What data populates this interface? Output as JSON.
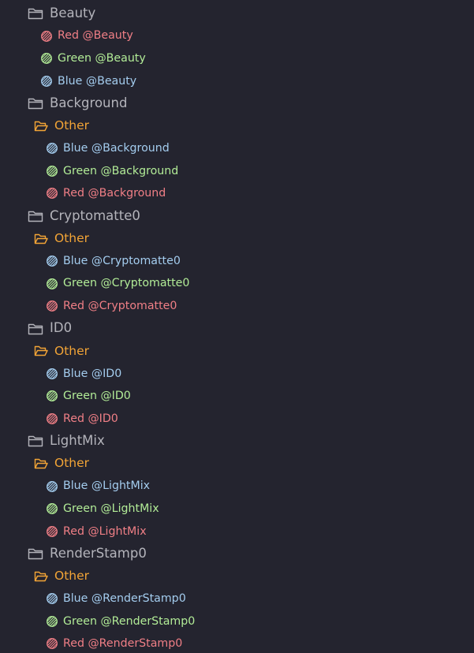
{
  "colors": {
    "background": "#24242f",
    "group_text": "#b4b4bb",
    "other_folder": "#f2a436",
    "red": "#f07f86",
    "green": "#b2ec97",
    "blue": "#a4cdef"
  },
  "tree": [
    {
      "label": "Beauty",
      "icon": "folder-icon",
      "children": [
        {
          "label": "Red @Beauty",
          "color": "red",
          "icon": "hatched-circle-icon"
        },
        {
          "label": "Green @Beauty",
          "color": "green",
          "icon": "hatched-circle-icon"
        },
        {
          "label": "Blue @Beauty",
          "color": "blue",
          "icon": "hatched-circle-icon"
        }
      ]
    },
    {
      "label": "Background",
      "icon": "folder-icon",
      "subfolder": {
        "label": "Other",
        "icon": "open-folder-icon",
        "children": [
          {
            "label": "Blue @Background",
            "color": "blue",
            "icon": "hatched-circle-icon"
          },
          {
            "label": "Green @Background",
            "color": "green",
            "icon": "hatched-circle-icon"
          },
          {
            "label": "Red @Background",
            "color": "red",
            "icon": "hatched-circle-icon"
          }
        ]
      }
    },
    {
      "label": "Cryptomatte0",
      "icon": "folder-icon",
      "subfolder": {
        "label": "Other",
        "icon": "open-folder-icon",
        "children": [
          {
            "label": "Blue @Cryptomatte0",
            "color": "blue",
            "icon": "hatched-circle-icon"
          },
          {
            "label": "Green @Cryptomatte0",
            "color": "green",
            "icon": "hatched-circle-icon"
          },
          {
            "label": "Red @Cryptomatte0",
            "color": "red",
            "icon": "hatched-circle-icon"
          }
        ]
      }
    },
    {
      "label": "ID0",
      "icon": "folder-icon",
      "subfolder": {
        "label": "Other",
        "icon": "open-folder-icon",
        "children": [
          {
            "label": "Blue @ID0",
            "color": "blue",
            "icon": "hatched-circle-icon"
          },
          {
            "label": "Green @ID0",
            "color": "green",
            "icon": "hatched-circle-icon"
          },
          {
            "label": "Red @ID0",
            "color": "red",
            "icon": "hatched-circle-icon"
          }
        ]
      }
    },
    {
      "label": "LightMix",
      "icon": "folder-icon",
      "subfolder": {
        "label": "Other",
        "icon": "open-folder-icon",
        "children": [
          {
            "label": "Blue @LightMix",
            "color": "blue",
            "icon": "hatched-circle-icon"
          },
          {
            "label": "Green @LightMix",
            "color": "green",
            "icon": "hatched-circle-icon"
          },
          {
            "label": "Red @LightMix",
            "color": "red",
            "icon": "hatched-circle-icon"
          }
        ]
      }
    },
    {
      "label": "RenderStamp0",
      "icon": "folder-icon",
      "subfolder": {
        "label": "Other",
        "icon": "open-folder-icon",
        "children": [
          {
            "label": "Blue @RenderStamp0",
            "color": "blue",
            "icon": "hatched-circle-icon"
          },
          {
            "label": "Green @RenderStamp0",
            "color": "green",
            "icon": "hatched-circle-icon"
          },
          {
            "label": "Red @RenderStamp0",
            "color": "red",
            "icon": "hatched-circle-icon"
          }
        ]
      }
    }
  ]
}
